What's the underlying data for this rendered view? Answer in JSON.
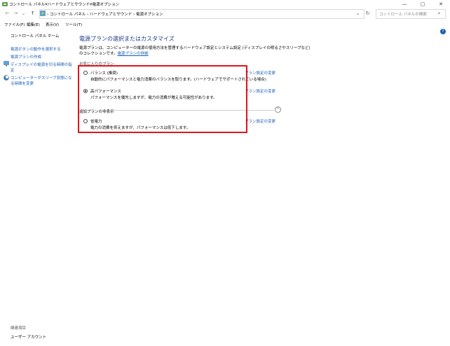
{
  "window": {
    "title": "コントロール パネル¥ハードウェアとサウンド¥電源オプション",
    "minimize": "—",
    "maximize": "▢",
    "close": "✕"
  },
  "nav": {
    "back": "←",
    "forward": "→",
    "recent": "⌄",
    "up": "↑",
    "breadcrumb": "›  コントロール パネル  ›  ハードウェアとサウンド  ›  電源オプション",
    "dropdown": "⌄",
    "refresh": "↻",
    "search_placeholder": "コントロール パネルの検索",
    "search_icon": "⌕"
  },
  "menu": [
    "ファイル(F)",
    "編集(E)",
    "表示(V)",
    "ツール(T)"
  ],
  "sidebar": {
    "home": "コントロール パネル ホーム",
    "items": [
      "電源ボタンの動作を選択する",
      "電源プランの作成",
      "ディスプレイの電源を切る時間の指",
      "定",
      "コンピューターがスリープ状態にな",
      "る時間を変更"
    ],
    "see_also": "関連項目",
    "user_accounts": "ユーザー アカウント"
  },
  "main": {
    "title": "電源プランの選択またはカスタマイズ",
    "desc_line1": "電源プランは、コンピューターの電源の使用方法を管理するハードウェア設定とシステム設定 (ディスプレイの明るさやスリープなど)",
    "desc_line2_pre": "のコレクションです。",
    "desc_link": "電源プランの詳細",
    "favorites_label": "お気に入りのプラン",
    "hidden_label": "追加プランの非表示",
    "expand_icon": "⌃",
    "help": "?"
  },
  "plans": [
    {
      "name": "バランス (推奨)",
      "desc": "自動的にパフォーマンスと電力消費のバランスを取ります。(ハードウェアでサポートされている場合)",
      "change": "プラン設定の変更",
      "selected": false
    },
    {
      "name": "高パフォーマンス",
      "desc": "パフォーマンスを優先しますが、電力の消費が増える可能性があります。",
      "change": "プラン設定の変更",
      "selected": true
    },
    {
      "name": "省電力",
      "desc": "電力の消費を抑えますが、パフォーマンスは低下します。",
      "change": "プラン設定の変更",
      "selected": false
    }
  ],
  "colors": {
    "highlight": "#e1141c",
    "link": "#1a5fb4",
    "title": "#1e3a8a"
  }
}
